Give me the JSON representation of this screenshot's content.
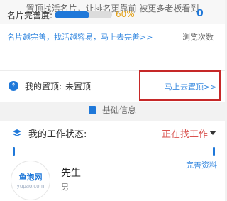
{
  "banner": {
    "text": "置顶找活名片，让排名更靠前 被更多老板看到"
  },
  "completeness": {
    "label": "名片完善度:",
    "percent_text": "60%",
    "percent": 0.6,
    "promo_link": "名片越完善，找活越容易，马上去完善>>"
  },
  "views": {
    "count": "0",
    "label": "浏览次数"
  },
  "pin": {
    "icon": "upload-pin-icon",
    "label": "我的置顶:",
    "value": "未置顶",
    "button": "马上去置顶>>"
  },
  "section": {
    "title": "基础信息",
    "icon": "document-icon"
  },
  "work_status": {
    "icon": "layers-icon",
    "label": "我的工作状态:",
    "value": "正在找工作"
  },
  "profile": {
    "complete_link": "完善资料",
    "logo_zh": "鱼泡网",
    "logo_en": "yupao.com",
    "name": "先生",
    "gender": "男"
  },
  "colors": {
    "accent": "#1f78d9",
    "warning": "#e3a117",
    "status": "#d9534f",
    "highlight_box": "#c62828"
  }
}
